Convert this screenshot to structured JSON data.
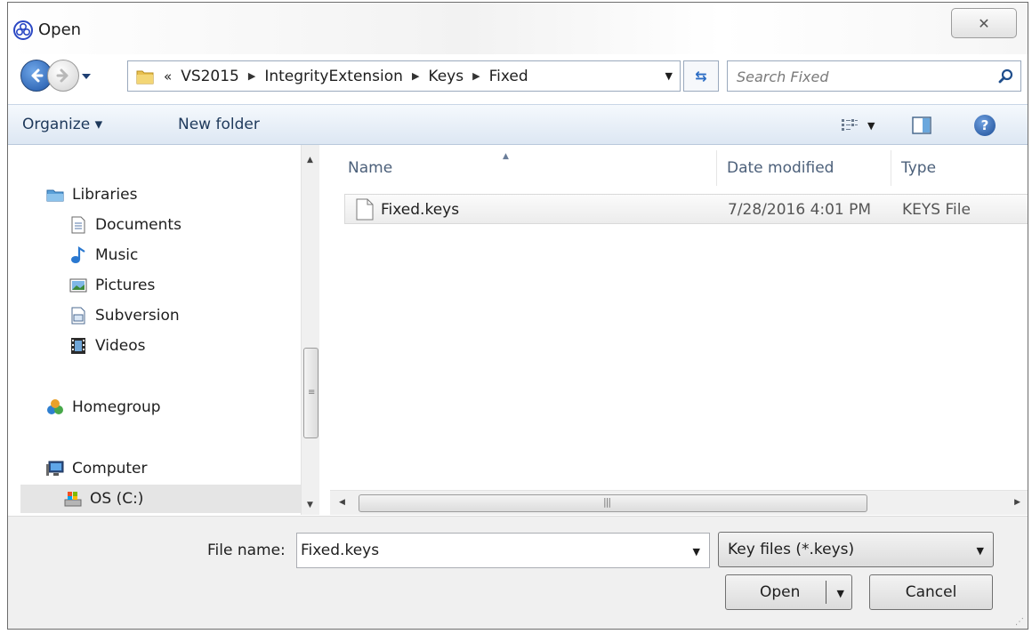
{
  "window": {
    "title": "Open",
    "close_glyph": "✕"
  },
  "address": {
    "overflow": "«",
    "crumbs": [
      "VS2015",
      "IntegrityExtension",
      "Keys",
      "Fixed"
    ]
  },
  "search": {
    "placeholder": "Search Fixed"
  },
  "toolbar": {
    "organize_label": "Organize ▾",
    "new_folder_label": "New folder"
  },
  "nav": {
    "libraries": "Libraries",
    "documents": "Documents",
    "music": "Music",
    "pictures": "Pictures",
    "subversion": "Subversion",
    "videos": "Videos",
    "homegroup": "Homegroup",
    "computer": "Computer",
    "os_drive": "OS (C:)"
  },
  "file_list": {
    "columns": {
      "name": "Name",
      "date_modified": "Date modified",
      "type": "Type"
    },
    "rows": [
      {
        "name": "Fixed.keys",
        "date_modified": "7/28/2016 4:01 PM",
        "type": "KEYS File"
      }
    ]
  },
  "bottom": {
    "file_name_label": "File name:",
    "file_name_value": "Fixed.keys",
    "filter_value": "Key files (*.keys)",
    "open_label": "Open",
    "cancel_label": "Cancel"
  },
  "colors": {
    "toolbar_text": "#1e395b",
    "column_header_text": "#4c607a",
    "accent_blue": "#2b6cc4"
  }
}
